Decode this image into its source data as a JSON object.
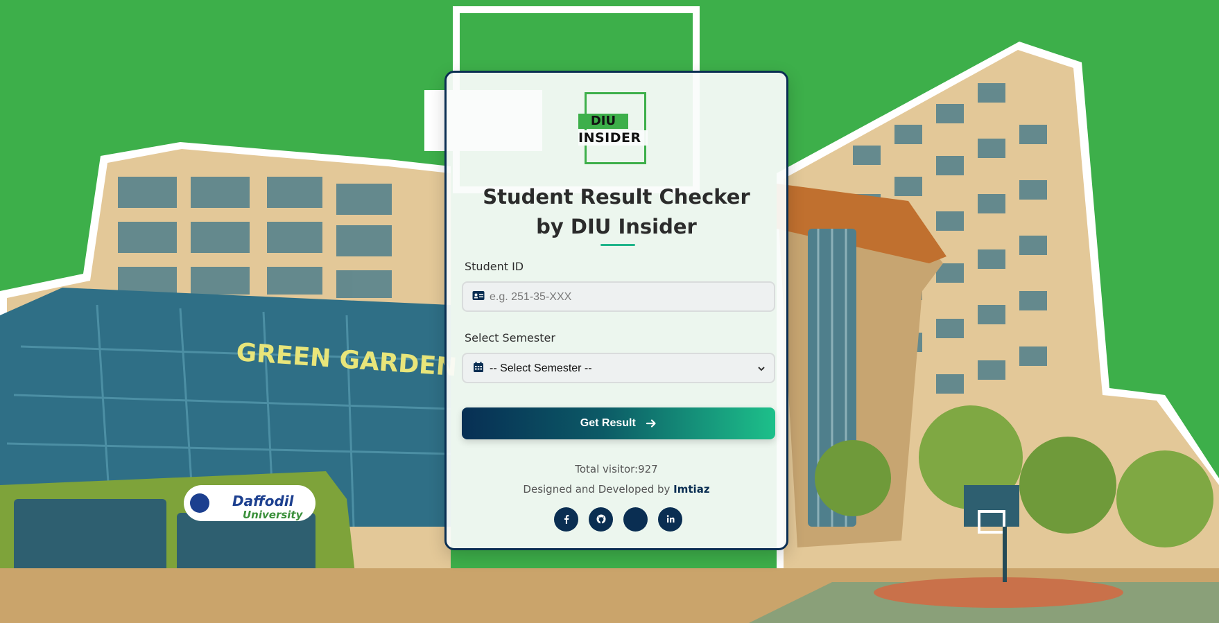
{
  "logo": {
    "line1": "DIU",
    "line2": "INSIDER"
  },
  "background": {
    "sign_text": "GREEN GARDEN",
    "bus_logo_1": "Daffodil",
    "bus_logo_2": "University"
  },
  "title": {
    "line1": "Student Result Checker",
    "line2": "by DIU Insider"
  },
  "form": {
    "student_id_label": "Student ID",
    "student_id_placeholder": "e.g. 251-35-XXX",
    "semester_label": "Select Semester",
    "semester_selected": "-- Select Semester --",
    "submit_label": "Get Result"
  },
  "footer": {
    "visitor_text": "Total visitor:927",
    "credit_prefix": "Designed and Developed by",
    "credit_name": "Imtiaz"
  },
  "socials": [
    {
      "name": "facebook-icon"
    },
    {
      "name": "github-icon"
    },
    {
      "name": "blank-icon"
    },
    {
      "name": "linkedin-icon"
    }
  ],
  "colors": {
    "background": "#3daf4a",
    "brand_dark": "#0a2e52",
    "accent": "#1dc08a"
  }
}
